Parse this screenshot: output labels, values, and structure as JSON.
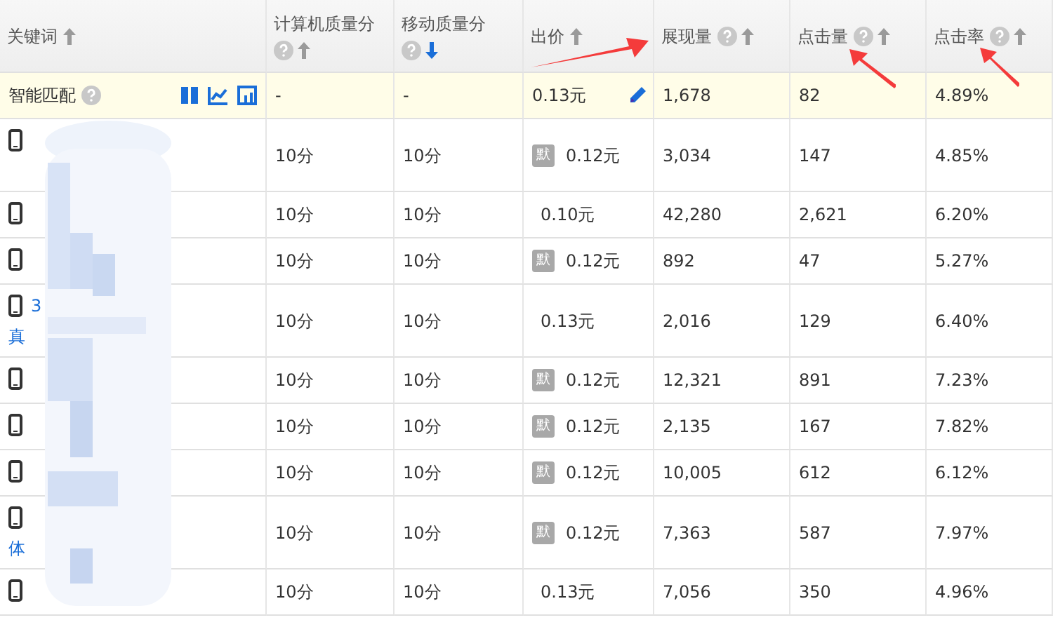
{
  "columns": [
    {
      "label": "关键词",
      "help": false,
      "sort_active": false
    },
    {
      "label": "计算机质量分",
      "help": true,
      "sort_active": false
    },
    {
      "label": "移动质量分",
      "help": true,
      "sort_active": true
    },
    {
      "label": "出价",
      "help": false,
      "sort_active": false
    },
    {
      "label": "展现量",
      "help": true,
      "sort_active": false
    },
    {
      "label": "点击量",
      "help": true,
      "sort_active": false
    },
    {
      "label": "点击率",
      "help": true,
      "sort_active": false
    }
  ],
  "smart_match": {
    "label": "智能匹配",
    "pc_score": "-",
    "mobile_score": "-",
    "bid": "0.13元",
    "impressions": "1,678",
    "clicks": "82",
    "ctr": "4.89%"
  },
  "rows": [
    {
      "two_line": true,
      "keyword": {},
      "pc_score": "10分",
      "mobile_score": "10分",
      "default_badge": "默",
      "bid": "0.12元",
      "impressions": "3,034",
      "clicks": "147",
      "ctr": "4.85%"
    },
    {
      "two_line": false,
      "keyword": {},
      "pc_score": "10分",
      "mobile_score": "10分",
      "bid": "0.10元",
      "impressions": "42,280",
      "clicks": "2,621",
      "ctr": "6.20%"
    },
    {
      "two_line": false,
      "keyword": {},
      "pc_score": "10分",
      "mobile_score": "10分",
      "default_badge": "默",
      "bid": "0.12元",
      "impressions": "892",
      "clicks": "47",
      "ctr": "5.27%"
    },
    {
      "two_line": true,
      "keyword": {
        "line_1": "3",
        "line_2": "真"
      },
      "pc_score": "10分",
      "mobile_score": "10分",
      "bid": "0.13元",
      "impressions": "2,016",
      "clicks": "129",
      "ctr": "6.40%"
    },
    {
      "two_line": false,
      "keyword": {},
      "pc_score": "10分",
      "mobile_score": "10分",
      "default_badge": "默",
      "bid": "0.12元",
      "impressions": "12,321",
      "clicks": "891",
      "ctr": "7.23%"
    },
    {
      "two_line": false,
      "keyword": {},
      "pc_score": "10分",
      "mobile_score": "10分",
      "default_badge": "默",
      "bid": "0.12元",
      "impressions": "2,135",
      "clicks": "167",
      "ctr": "7.82%"
    },
    {
      "two_line": false,
      "keyword": {},
      "pc_score": "10分",
      "mobile_score": "10分",
      "default_badge": "默",
      "bid": "0.12元",
      "impressions": "10,005",
      "clicks": "612",
      "ctr": "6.12%"
    },
    {
      "two_line": true,
      "keyword": {
        "line_2": "体"
      },
      "pc_score": "10分",
      "mobile_score": "10分",
      "default_badge": "默",
      "bid": "0.12元",
      "impressions": "7,363",
      "clicks": "587",
      "ctr": "7.97%"
    },
    {
      "two_line": false,
      "keyword": {},
      "pc_score": "10分",
      "mobile_score": "10分",
      "bid": "0.13元",
      "impressions": "7,056",
      "clicks": "350",
      "ctr": "4.96%"
    }
  ]
}
